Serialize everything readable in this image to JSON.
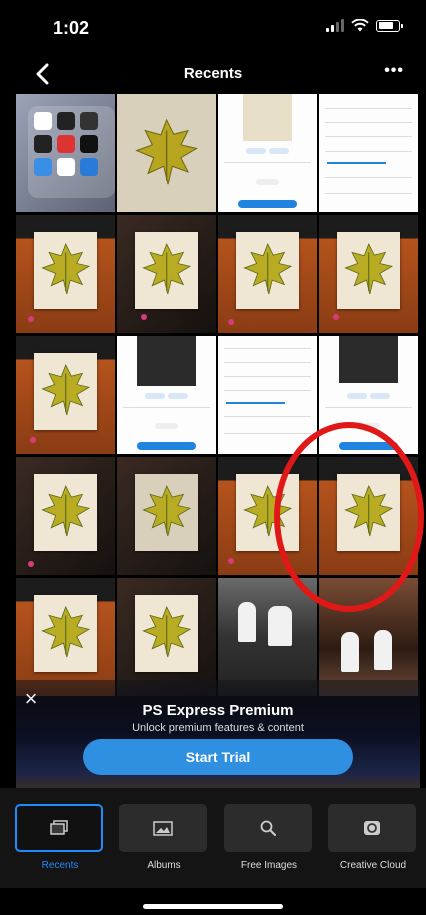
{
  "status_bar": {
    "time": "1:02"
  },
  "nav": {
    "title": "Recents",
    "more_label": "•••"
  },
  "premium": {
    "title": "PS Express Premium",
    "subtitle": "Unlock premium features & content",
    "cta_label": "Start Trial",
    "close_label": "×"
  },
  "tabs": [
    {
      "label": "Recents",
      "icon": "recents-icon",
      "active": true
    },
    {
      "label": "Albums",
      "icon": "albums-icon",
      "active": false
    },
    {
      "label": "Free Images",
      "icon": "search-icon",
      "active": false
    },
    {
      "label": "Creative Cloud",
      "icon": "creative-cloud-icon",
      "active": false
    }
  ],
  "colors": {
    "accent": "#1f8bff",
    "cta": "#2f8fe0",
    "annotation": "#e11818",
    "background": "#000000"
  }
}
